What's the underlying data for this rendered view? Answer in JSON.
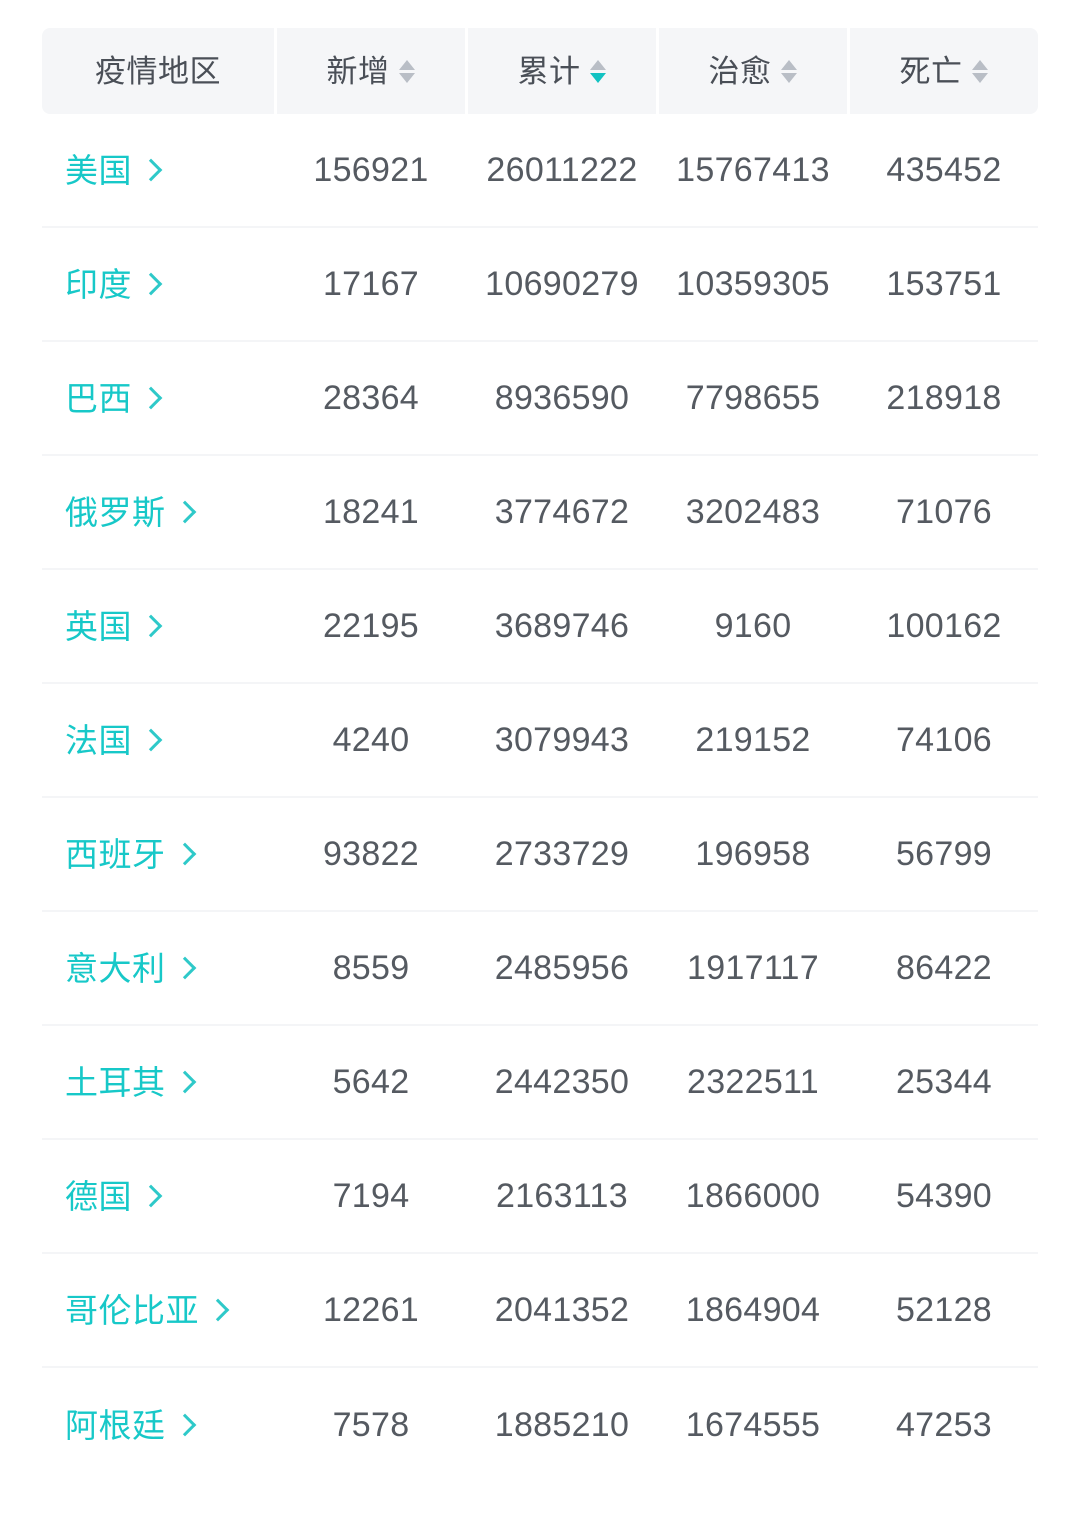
{
  "table": {
    "columns": [
      {
        "key": "region",
        "label": "疫情地区",
        "sortable": false,
        "sort_state": "none"
      },
      {
        "key": "new",
        "label": "新增",
        "sortable": true,
        "sort_state": "none"
      },
      {
        "key": "total",
        "label": "累计",
        "sortable": true,
        "sort_state": "desc"
      },
      {
        "key": "cured",
        "label": "治愈",
        "sortable": true,
        "sort_state": "none"
      },
      {
        "key": "deaths",
        "label": "死亡",
        "sortable": true,
        "sort_state": "none"
      }
    ],
    "rows": [
      {
        "region": "美国",
        "new": "156921",
        "total": "26011222",
        "cured": "15767413",
        "deaths": "435452"
      },
      {
        "region": "印度",
        "new": "17167",
        "total": "10690279",
        "cured": "10359305",
        "deaths": "153751"
      },
      {
        "region": "巴西",
        "new": "28364",
        "total": "8936590",
        "cured": "7798655",
        "deaths": "218918"
      },
      {
        "region": "俄罗斯",
        "new": "18241",
        "total": "3774672",
        "cured": "3202483",
        "deaths": "71076"
      },
      {
        "region": "英国",
        "new": "22195",
        "total": "3689746",
        "cured": "9160",
        "deaths": "100162"
      },
      {
        "region": "法国",
        "new": "4240",
        "total": "3079943",
        "cured": "219152",
        "deaths": "74106"
      },
      {
        "region": "西班牙",
        "new": "93822",
        "total": "2733729",
        "cured": "196958",
        "deaths": "56799"
      },
      {
        "region": "意大利",
        "new": "8559",
        "total": "2485956",
        "cured": "1917117",
        "deaths": "86422"
      },
      {
        "region": "土耳其",
        "new": "5642",
        "total": "2442350",
        "cured": "2322511",
        "deaths": "25344"
      },
      {
        "region": "德国",
        "new": "7194",
        "total": "2163113",
        "cured": "1866000",
        "deaths": "54390"
      },
      {
        "region": "哥伦比亚",
        "new": "12261",
        "total": "2041352",
        "cured": "1864904",
        "deaths": "52128"
      },
      {
        "region": "阿根廷",
        "new": "7578",
        "total": "1885210",
        "cured": "1674555",
        "deaths": "47253"
      }
    ]
  },
  "icons": {
    "sort": "sort-arrows-icon",
    "chevron": "chevron-right-icon"
  },
  "colors": {
    "accent_teal": "#17c8c8",
    "sort_active": "#12c2c2",
    "sort_inactive": "#b9bec6",
    "header_bg": "#f5f6f8",
    "header_text": "#4a4f57",
    "value_text": "#555a61",
    "row_divider": "#f4f5f7"
  }
}
